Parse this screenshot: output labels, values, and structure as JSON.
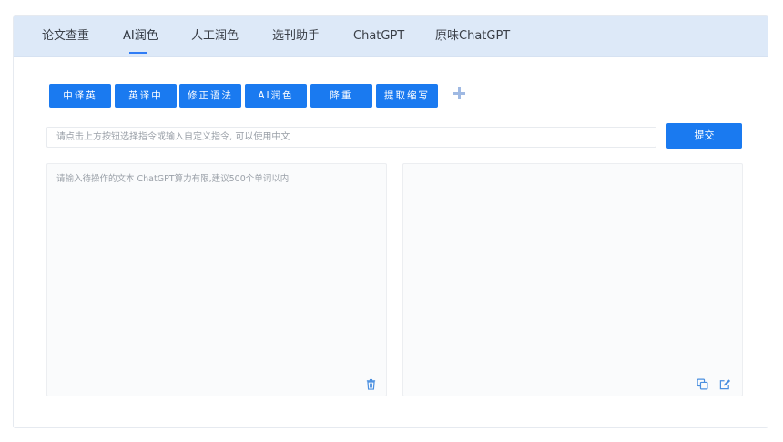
{
  "tabs": [
    {
      "label": "论文查重"
    },
    {
      "label": "AI润色"
    },
    {
      "label": "人工润色"
    },
    {
      "label": "选刊助手"
    },
    {
      "label": "ChatGPT"
    },
    {
      "label": "原味ChatGPT"
    }
  ],
  "active_tab": "AI润色",
  "commands": [
    {
      "label": "中译英"
    },
    {
      "label": "英译中"
    },
    {
      "label": "修正语法"
    },
    {
      "label": "AI润色"
    },
    {
      "label": "降重"
    },
    {
      "label": "提取缩写"
    }
  ],
  "command_input": {
    "placeholder": "请点击上方按钮选择指令或输入自定义指令, 可以使用中文",
    "value": ""
  },
  "submit_label": "提交",
  "source_text": {
    "placeholder": "请输入待操作的文本 ChatGPT算力有限,建议500个单词以内",
    "value": ""
  },
  "result_text": {
    "value": ""
  },
  "icons": {
    "add": "plus-icon",
    "clear": "trash-icon",
    "copy": "copy-icon",
    "edit": "edit-icon"
  },
  "colors": {
    "accent": "#1a7af0",
    "tabbar_bg": "#dde9f8",
    "icon": "#4a8fe0"
  }
}
